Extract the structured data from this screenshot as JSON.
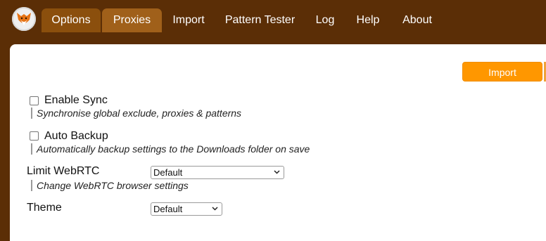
{
  "nav": {
    "tabs": [
      {
        "label": "Options"
      },
      {
        "label": "Proxies"
      },
      {
        "label": "Import"
      },
      {
        "label": "Pattern Tester"
      },
      {
        "label": "Log"
      },
      {
        "label": "Help"
      },
      {
        "label": "About"
      }
    ]
  },
  "toolbar": {
    "import_label": "Import"
  },
  "settings": {
    "enable_sync": {
      "label": "Enable Sync",
      "hint": "Synchronise global exclude, proxies & patterns",
      "checked": false
    },
    "auto_backup": {
      "label": "Auto Backup",
      "hint": "Automatically backup settings to the Downloads folder on save",
      "checked": false
    },
    "limit_webrtc": {
      "label": "Limit WebRTC",
      "value": "Default",
      "hint": "Change WebRTC browser settings"
    },
    "theme": {
      "label": "Theme",
      "value": "Default"
    }
  },
  "colors": {
    "brand_brown": "#5b2e06",
    "tab_brown": "#8b4f0d",
    "accent_orange": "#ff9700"
  },
  "icons": {
    "logo": "fox-logo-icon",
    "dropdown": "chevron-down-icon"
  }
}
